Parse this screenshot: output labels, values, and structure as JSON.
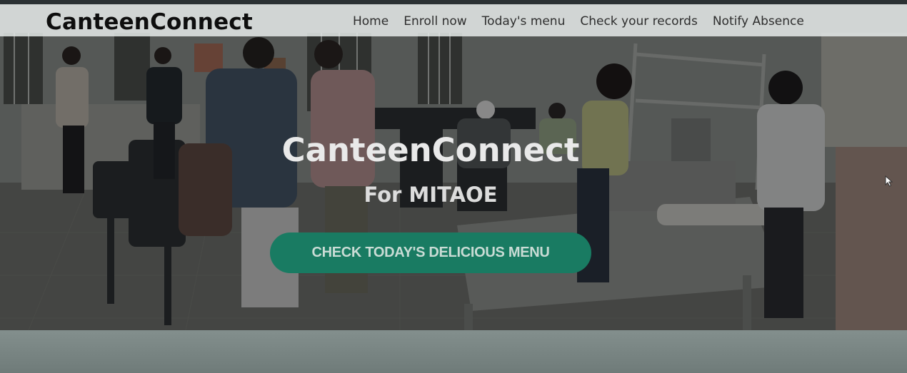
{
  "nav": {
    "brand": "CanteenConnect",
    "links": [
      "Home",
      "Enroll now",
      "Today's menu",
      "Check your records",
      "Notify Absence"
    ]
  },
  "hero": {
    "title": "CanteenConnect",
    "subtitle": "For MITAOE",
    "cta_label": "CHECK TODAY'S DELICIOUS MENU"
  },
  "colors": {
    "accent": "#197b62",
    "navbar_bg": "#e5eae9",
    "overlay": "#000000"
  },
  "icons": {
    "cursor": "mouse-pointer-icon"
  }
}
